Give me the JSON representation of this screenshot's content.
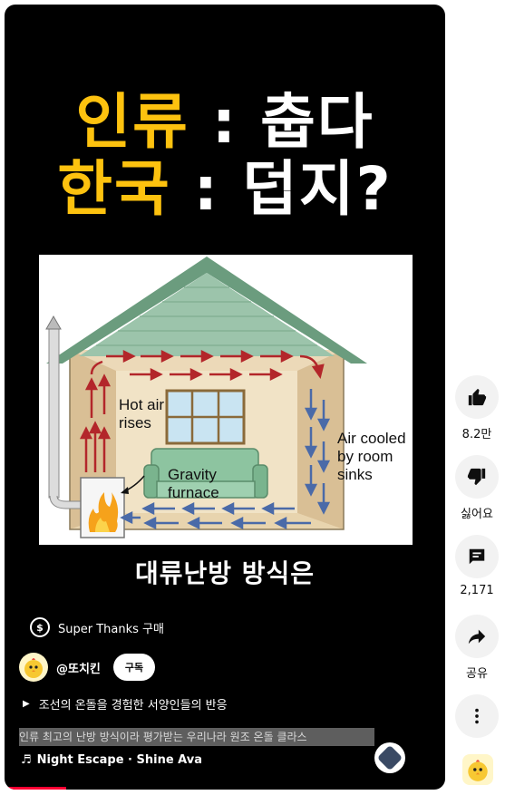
{
  "video": {
    "headline_line1_yellow": "인류",
    "headline_line1_white": " : 춥다",
    "headline_line2_yellow": "한국",
    "headline_line2_white": " : 덥지?",
    "diagram": {
      "label_hot_air": "Hot air\nrises",
      "label_gravity": "Gravity\nfurnace",
      "label_air_cooled": "Air cooled\nby room\nsinks"
    },
    "caption": "대류난방 방식은",
    "progress_fraction": 0.14
  },
  "overlay": {
    "super_thanks_label": "Super Thanks 구매",
    "channel_name": "@또치킨",
    "subscribe_label": "구독",
    "playlist_title": "조선의 온돌을 경험한 서양인들의 반응",
    "description": "인류 최고의 난방 방식이라 평가받는 우리나라 원조 온돌 클라스",
    "music": "Night Escape · Shine Ava"
  },
  "actions": {
    "like_count": "8.2만",
    "dislike_label": "싫어요",
    "comment_count": "2,171",
    "share_label": "공유"
  },
  "colors": {
    "headline_yellow": "#fdc20f",
    "progress_red": "#ff0033",
    "roof_green": "#7aaa8c",
    "hot_arrow": "#b3262a",
    "cool_arrow": "#4a6aa8"
  },
  "icons": [
    "super-thanks-icon",
    "play-icon",
    "music-note-icon",
    "like-icon",
    "dislike-icon",
    "comment-icon",
    "share-icon",
    "more-icon"
  ]
}
